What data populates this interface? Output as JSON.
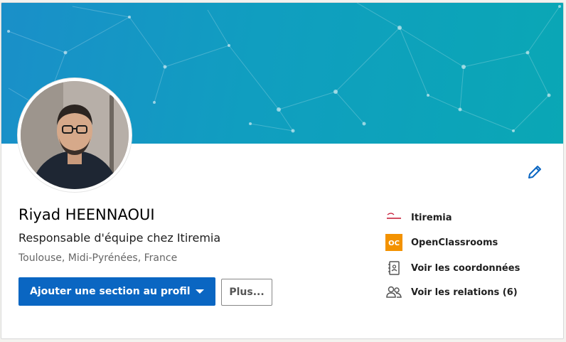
{
  "profile": {
    "name": "Riyad HEENNAOUI",
    "headline": "Responsable d'équipe chez Itiremia",
    "location": "Toulouse, Midi-Pyrénées, France"
  },
  "actions": {
    "primary_label": "Ajouter une section au profil",
    "secondary_label": "Plus..."
  },
  "sidebar": {
    "items": [
      {
        "label": "Itiremia",
        "icon": "itiremia-logo"
      },
      {
        "label": "OpenClassrooms",
        "icon": "openclassrooms-logo",
        "logo_text": "OC"
      },
      {
        "label": "Voir les coordonnées",
        "icon": "contact-card-icon"
      },
      {
        "label": "Voir les relations (6)",
        "icon": "people-icon"
      }
    ]
  },
  "colors": {
    "accent": "#0a66c2",
    "banner_start": "#1a8fc9",
    "banner_end": "#0aa7b5",
    "openclassrooms": "#f39200",
    "itiremia": "#c4122f"
  }
}
